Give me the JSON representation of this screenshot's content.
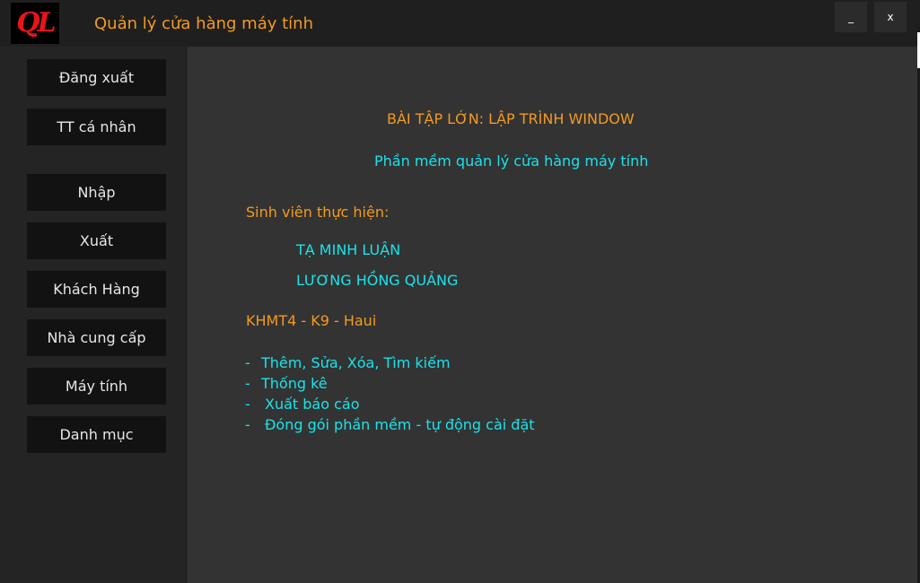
{
  "window": {
    "logo_text": "QL",
    "title": "Quản lý cửa hàng máy tính",
    "minimize_label": "_",
    "close_label": "x"
  },
  "sidebar": {
    "items": [
      {
        "label": "Đăng xuất"
      },
      {
        "label": "TT cá nhân"
      },
      {
        "label": "Nhập"
      },
      {
        "label": "Xuất"
      },
      {
        "label": "Khách Hàng"
      },
      {
        "label": "Nhà cung cấp"
      },
      {
        "label": "Máy tính"
      },
      {
        "label": "Danh mục"
      }
    ]
  },
  "main": {
    "heading": "BÀI TẬP LỚN: LẬP TRÌNH WINDOW",
    "subheading": "Phần mềm quản lý cửa hàng máy tính",
    "students_label": "Sinh viên thực hiện:",
    "students": [
      "TẠ MINH LUẬN",
      "LƯƠNG HỒNG QUẢNG"
    ],
    "class_info": "KHMT4 - K9 - Haui",
    "feature_bullet": "-",
    "features": [
      "Thêm, Sửa, Xóa, Tìm kiếm",
      "Thống kê",
      "Xuất báo cáo",
      "Đóng gói phần mềm - tự động cài đặt"
    ]
  },
  "colors": {
    "accent_orange": "#f39a21",
    "accent_cyan": "#19e3ea",
    "logo_red": "#e8141b",
    "content_bg": "#333333",
    "sidebar_bg": "#242424",
    "button_bg": "#121212"
  }
}
